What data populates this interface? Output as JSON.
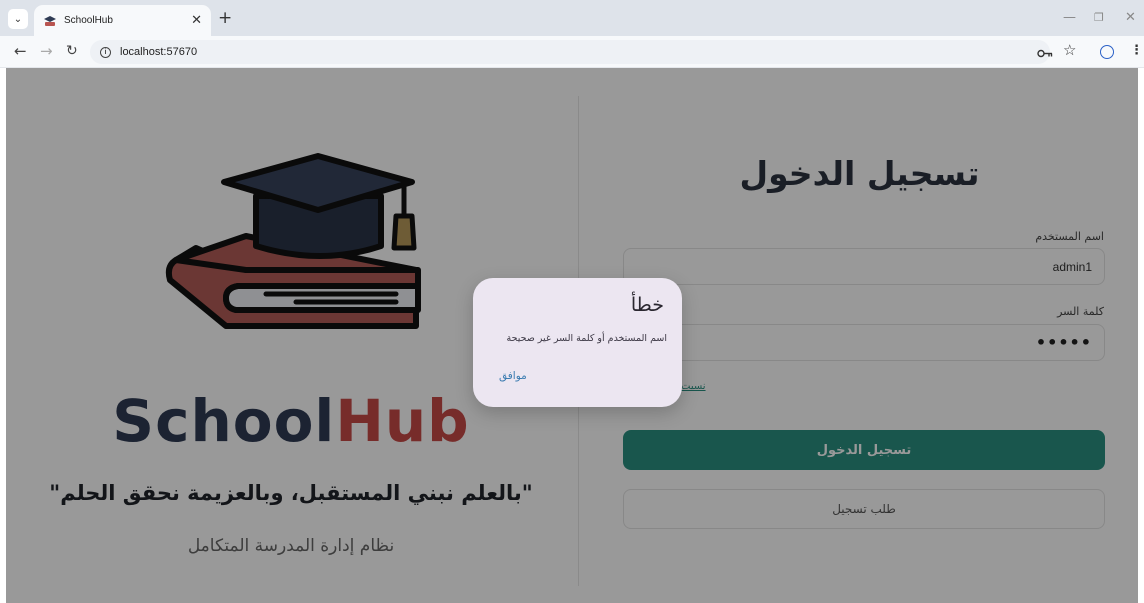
{
  "browser": {
    "tab_title": "SchoolHub",
    "url": "localhost:57670"
  },
  "left": {
    "brand_part1": "School",
    "brand_part2": "Hub",
    "slogan": "\"بالعلم نبني المستقبل، وبالعزيمة نحقق الحلم\"",
    "subtitle": "نظام إدارة المدرسة المتكامل"
  },
  "login": {
    "title": "تسجيل الدخول",
    "username_label": "اسم المستخدم",
    "username_value": "admin1",
    "password_label": "كلمة السر",
    "password_value": "•••••",
    "forgot_link": "نسيت",
    "login_button": "تسجيل الدخول",
    "register_button": "طلب تسجيل"
  },
  "dialog": {
    "title": "خطأ",
    "message": "اسم المستخدم أو كلمة السر غير صحيحة",
    "ok_button": "موافق"
  },
  "colors": {
    "brand_dark": "#2f3b54",
    "brand_red": "#c64a47",
    "accent_teal": "#2a8f80",
    "dialog_bg": "#ece6f1"
  }
}
